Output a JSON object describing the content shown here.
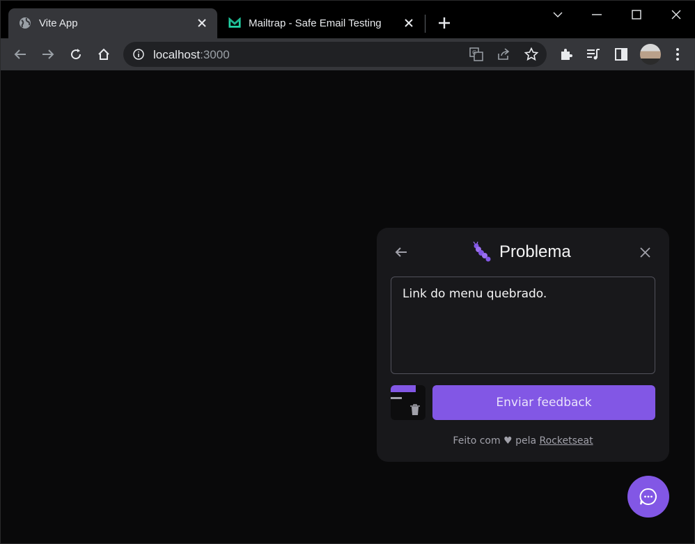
{
  "browser": {
    "tabs": [
      {
        "title": "Vite App",
        "icon": "globe-icon",
        "active": true
      },
      {
        "title": "Mailtrap - Safe Email Testing",
        "icon": "mailtrap-icon",
        "active": false
      }
    ],
    "address": {
      "host": "localhost",
      "port": ":3000"
    }
  },
  "widget": {
    "title": "Problema",
    "feedback_text": "Link do menu quebrado.",
    "submit_label": "Enviar feedback",
    "footer": {
      "prefix": "Feito com",
      "heart": "♥",
      "middle": "pela",
      "link": "Rocketseat"
    }
  },
  "colors": {
    "accent": "#8257e5",
    "panel": "#18181b",
    "background": "#09090a",
    "chrome_toolbar": "#35363a"
  }
}
